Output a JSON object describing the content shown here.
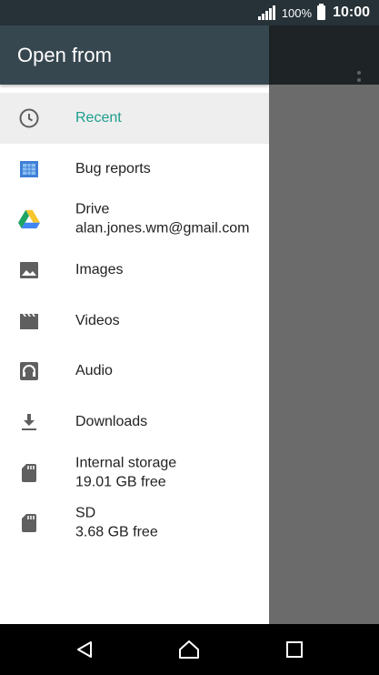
{
  "status_bar": {
    "battery_percent": "100%",
    "time": "10:00"
  },
  "drawer": {
    "title": "Open from",
    "items": [
      {
        "label": "Recent",
        "icon": "clock-icon",
        "active": true
      },
      {
        "label": "Bug reports",
        "icon": "bug-reports-icon"
      },
      {
        "label": "Drive",
        "sub": "alan.jones.wm@gmail.com",
        "icon": "google-drive-icon"
      },
      {
        "label": "Images",
        "icon": "image-icon"
      },
      {
        "label": "Videos",
        "icon": "video-icon"
      },
      {
        "label": "Audio",
        "icon": "headphones-icon"
      },
      {
        "label": "Downloads",
        "icon": "download-icon"
      },
      {
        "label": "Internal storage",
        "sub": "19.01 GB free",
        "icon": "sd-card-icon"
      },
      {
        "label": "SD",
        "sub": "3.68 GB free",
        "icon": "sd-card-icon"
      }
    ]
  },
  "colors": {
    "header": "#37474f",
    "accent": "#1e9e8e",
    "status_bar": "#263238"
  }
}
